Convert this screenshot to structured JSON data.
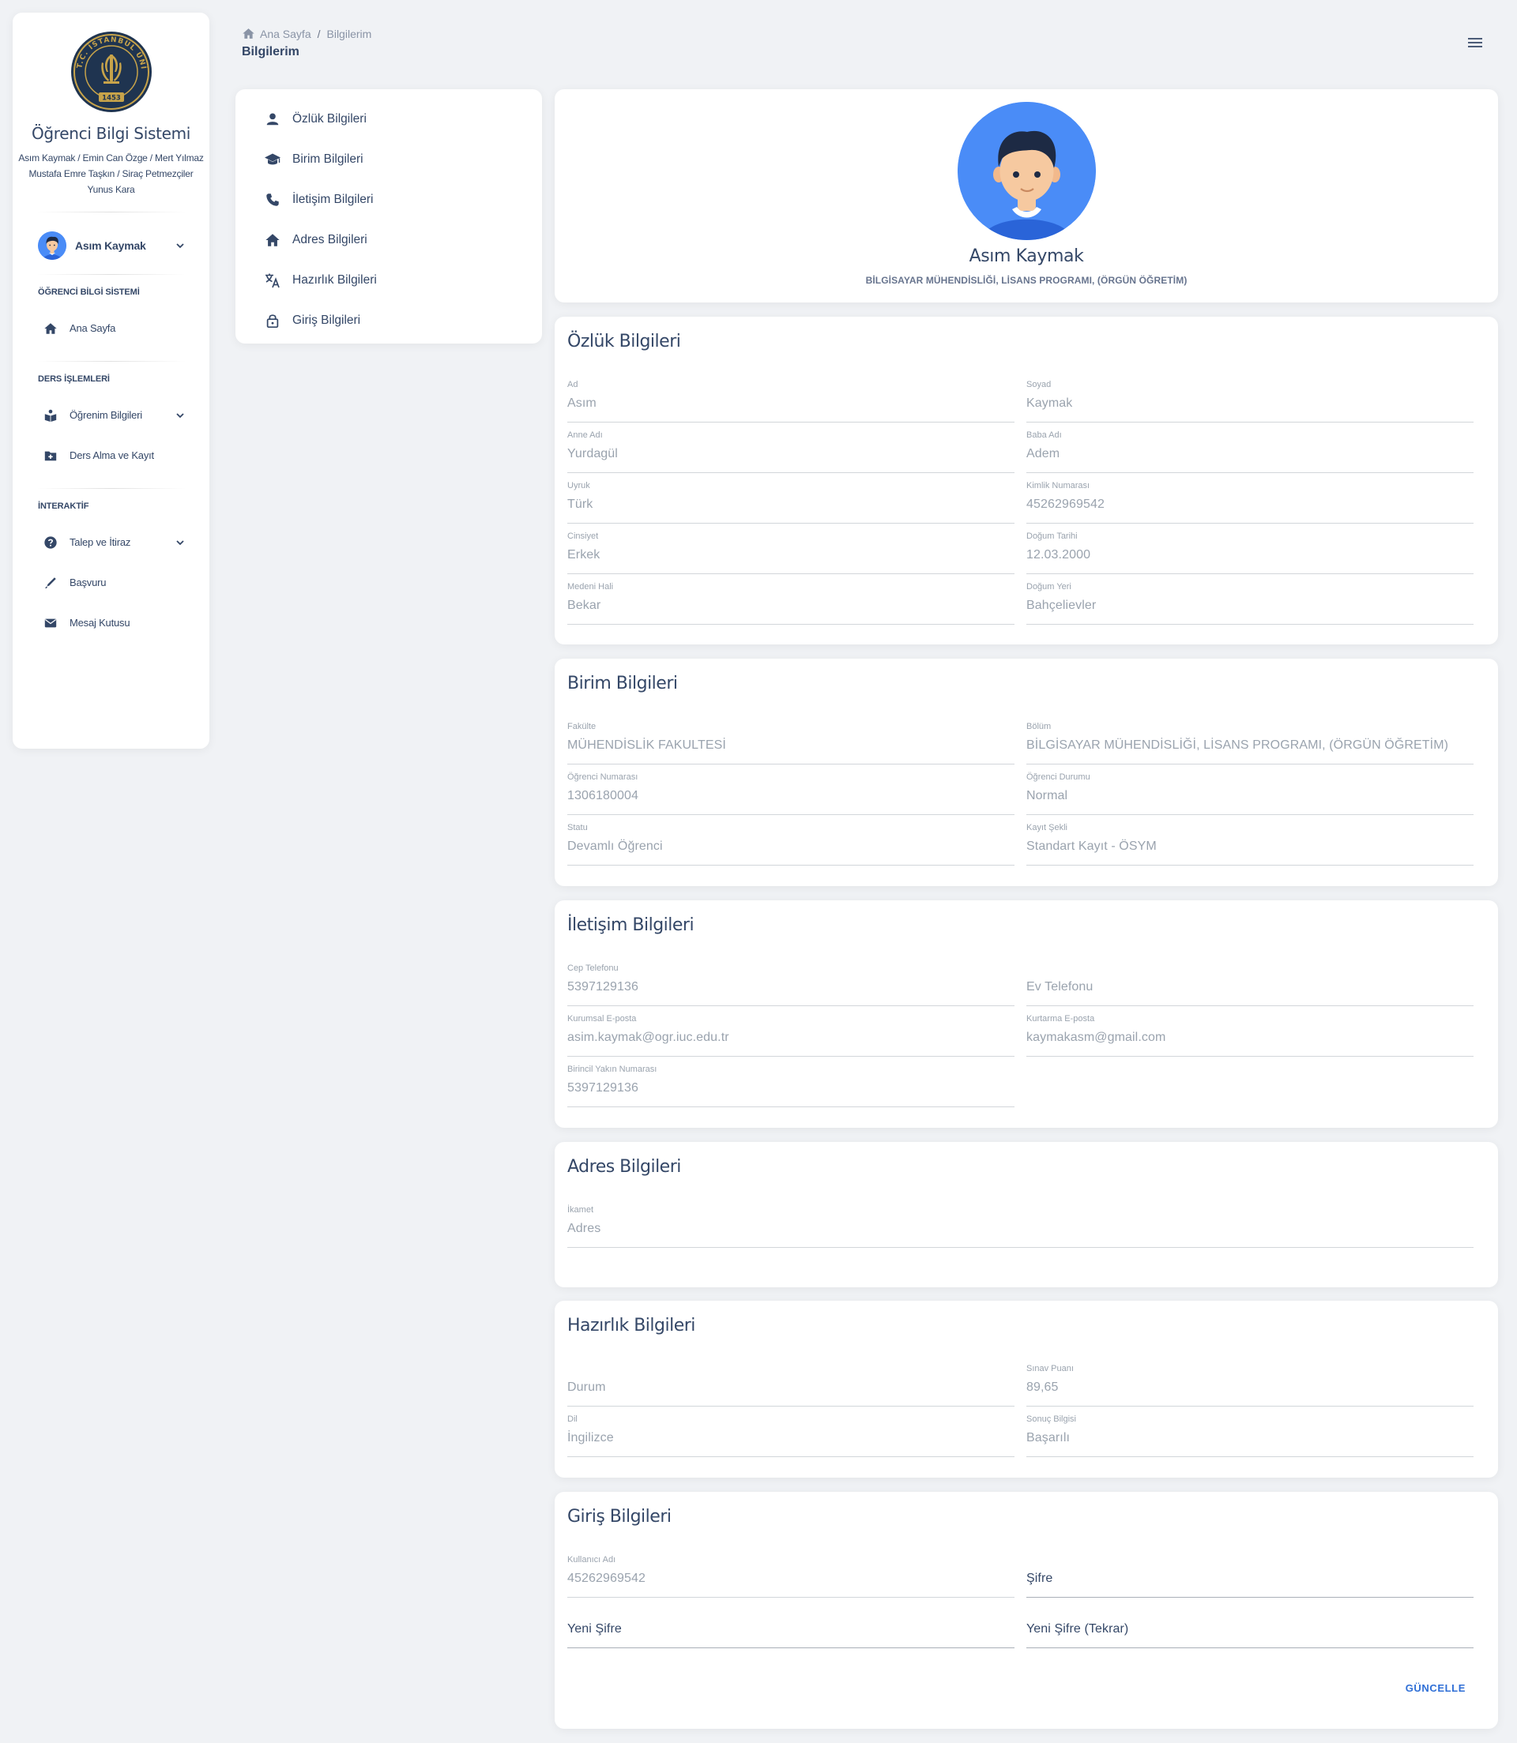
{
  "colors": {
    "accent": "#2f6fd6",
    "text": "#344767",
    "muted": "#9aa3ae",
    "bg": "#f0f2f5",
    "avatar_bg": "#4a8cf7"
  },
  "sidebar": {
    "logo_icon": "university-seal",
    "logo_text": "T.C. İSTANBUL ÜNİVERSİTESİ",
    "logo_year": "1453",
    "app_title": "Öğrenci Bilgi Sistemi",
    "authors": [
      "Asım Kaymak / Emin Can Özge / Mert Yılmaz",
      "Mustafa Emre Taşkın / Siraç Petmezçiler",
      "Yunus Kara"
    ],
    "user": {
      "name": "Asım Kaymak"
    },
    "sections": [
      {
        "title": "ÖĞRENCİ BİLGİ SİSTEMİ",
        "items": [
          {
            "label": "Ana Sayfa",
            "icon": "home-icon",
            "expandable": false
          }
        ]
      },
      {
        "title": "DERS İŞLEMLERİ",
        "items": [
          {
            "label": "Öğrenim Bilgileri",
            "icon": "book-reader-icon",
            "expandable": true
          },
          {
            "label": "Ders Alma ve Kayıt",
            "icon": "folder-plus-icon",
            "expandable": false
          }
        ]
      },
      {
        "title": "İNTERAKTİF",
        "items": [
          {
            "label": "Talep ve İtiraz",
            "icon": "help-circle-icon",
            "expandable": true
          },
          {
            "label": "Başvuru",
            "icon": "pen-icon",
            "expandable": false
          },
          {
            "label": "Mesaj Kutusu",
            "icon": "mail-icon",
            "expandable": false
          }
        ]
      }
    ]
  },
  "header": {
    "breadcrumb": [
      "Ana Sayfa",
      "Bilgilerim"
    ],
    "title": "Bilgilerim"
  },
  "menu": {
    "items": [
      {
        "label": "Özlük Bilgileri",
        "icon": "person-icon"
      },
      {
        "label": "Birim Bilgileri",
        "icon": "graduation-cap-icon"
      },
      {
        "label": "İletişim Bilgileri",
        "icon": "phone-icon"
      },
      {
        "label": "Adres Bilgileri",
        "icon": "home-icon"
      },
      {
        "label": "Hazırlık Bilgileri",
        "icon": "translate-icon"
      },
      {
        "label": "Giriş Bilgileri",
        "icon": "lock-icon"
      }
    ]
  },
  "profile": {
    "name": "Asım Kaymak",
    "department": "BİLGİSAYAR MÜHENDİSLİĞİ, LİSANS PROGRAMI, (ÖRGÜN ÖĞRETİM)"
  },
  "ozluk": {
    "title": "Özlük Bilgileri",
    "fields": [
      {
        "label": "Ad",
        "value": "Asım"
      },
      {
        "label": "Soyad",
        "value": "Kaymak"
      },
      {
        "label": "Anne Adı",
        "value": "Yurdagül"
      },
      {
        "label": "Baba Adı",
        "value": "Adem"
      },
      {
        "label": "Uyruk",
        "value": "Türk"
      },
      {
        "label": "Kimlik Numarası",
        "value": "45262969542"
      },
      {
        "label": "Cinsiyet",
        "value": "Erkek"
      },
      {
        "label": "Doğum Tarihi",
        "value": "12.03.2000"
      },
      {
        "label": "Medeni Hali",
        "value": "Bekar"
      },
      {
        "label": "Doğum Yeri",
        "value": "Bahçelievler"
      }
    ]
  },
  "birim": {
    "title": "Birim Bilgileri",
    "fields": [
      {
        "label": "Fakülte",
        "value": "MÜHENDİSLİK FAKULTESİ"
      },
      {
        "label": "Bölüm",
        "value": "BİLGİSAYAR MÜHENDİSLİĞİ, LİSANS PROGRAMI, (ÖRGÜN ÖĞRETİM)"
      },
      {
        "label": "Öğrenci Numarası",
        "value": "1306180004"
      },
      {
        "label": "Öğrenci Durumu",
        "value": "Normal"
      },
      {
        "label": "Statu",
        "value": "Devamlı Öğrenci"
      },
      {
        "label": "Kayıt Şekli",
        "value": "Standart Kayıt - ÖSYM"
      }
    ]
  },
  "iletisim": {
    "title": "İletişim Bilgileri",
    "fields": [
      {
        "label": "Cep Telefonu",
        "value": "5397129136"
      },
      {
        "label": "",
        "value": "Ev Telefonu"
      },
      {
        "label": "Kurumsal E-posta",
        "value": "asim.kaymak@ogr.iuc.edu.tr"
      },
      {
        "label": "Kurtarma E-posta",
        "value": "kaymakasm@gmail.com"
      },
      {
        "label": "Birincil Yakın Numarası",
        "value": "5397129136"
      }
    ]
  },
  "adres": {
    "title": "Adres Bilgileri",
    "fields": [
      {
        "label": "İkamet",
        "value": "Adres"
      }
    ]
  },
  "hazirlik": {
    "title": "Hazırlık Bilgileri",
    "fields": [
      {
        "label": "",
        "value": "Durum"
      },
      {
        "label": "Sınav Puanı",
        "value": "89,65"
      },
      {
        "label": "Dil",
        "value": "İngilizce"
      },
      {
        "label": "Sonuç Bilgisi",
        "value": "Başarılı"
      }
    ]
  },
  "giris": {
    "title": "Giriş Bilgileri",
    "fields": [
      {
        "label": "Kullanıcı Adı",
        "value": "45262969542"
      },
      {
        "label": "",
        "value": "Şifre"
      },
      {
        "label": "",
        "value": "Yeni Şifre"
      },
      {
        "label": "",
        "value": "Yeni Şifre (Tekrar)"
      }
    ],
    "button": "GÜNCELLE"
  }
}
